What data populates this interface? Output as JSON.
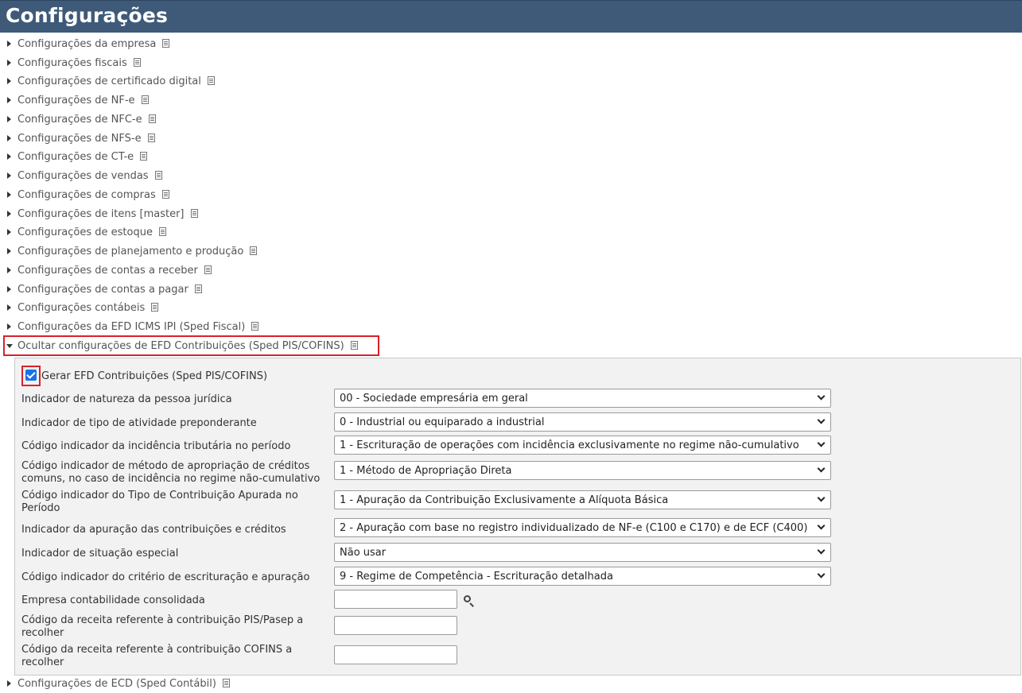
{
  "header": {
    "title": "Configurações"
  },
  "menu": {
    "items": [
      {
        "label": "Configurações da empresa"
      },
      {
        "label": "Configurações fiscais"
      },
      {
        "label": "Configurações de certificado digital"
      },
      {
        "label": "Configurações de NF-e"
      },
      {
        "label": "Configurações de NFC-e"
      },
      {
        "label": "Configurações de NFS-e"
      },
      {
        "label": "Configurações de CT-e"
      },
      {
        "label": "Configurações de vendas"
      },
      {
        "label": "Configurações de compras"
      },
      {
        "label": "Configurações de itens [master]"
      },
      {
        "label": "Configurações de estoque"
      },
      {
        "label": "Configurações de planejamento e produção"
      },
      {
        "label": "Configurações de contas a receber"
      },
      {
        "label": "Configurações de contas a pagar"
      },
      {
        "label": "Configurações contábeis"
      },
      {
        "label": "Configurações da EFD ICMS IPI (Sped Fiscal)"
      }
    ],
    "expanded": {
      "label": "Ocultar configurações de EFD Contribuições (Sped PIS/COFINS)"
    },
    "after": {
      "label": "Configurações de ECD (Sped Contábil)"
    }
  },
  "panel": {
    "checkbox": {
      "label": "Gerar EFD Contribuições (Sped PIS/COFINS)",
      "checked": true
    },
    "fields": [
      {
        "label": "Indicador de natureza da pessoa jurídica",
        "value": "00 - Sociedade empresária em geral"
      },
      {
        "label": "Indicador de tipo de atividade preponderante",
        "value": "0 - Industrial ou equiparado a industrial"
      },
      {
        "label": "Código indicador da incidência tributária no período",
        "value": "1 - Escrituração de operações com incidência exclusivamente no regime não-cumulativo"
      },
      {
        "label_line1": "Código indicador de método de apropriação de créditos",
        "label_line2": "comuns, no caso de incidência no regime não-cumulativo",
        "value": "1 - Método de Apropriação Direta"
      },
      {
        "label_line1": "Código indicador do Tipo de Contribuição Apurada no",
        "label_line2": "Período",
        "value": "1 - Apuração da Contribuição Exclusivamente a Alíquota Básica"
      },
      {
        "label": "Indicador da apuração das contribuições e créditos",
        "value": "2 - Apuração com base no registro individualizado de NF-e (C100 e C170) e de ECF (C400)"
      },
      {
        "label": "Indicador de situação especial",
        "value": "Não usar"
      },
      {
        "label": "Código indicador do critério de escrituração e apuração",
        "value": "9 - Regime de Competência - Escrituração detalhada"
      }
    ],
    "empresa_consolidada": {
      "label": "Empresa contabilidade consolidada",
      "value": ""
    },
    "receita_pis": {
      "label_line1": "Código da receita referente à contribuição PIS/Pasep a",
      "label_line2": "recolher",
      "value": ""
    },
    "receita_cofins": {
      "label_line1": "Código da receita referente à contribuição COFINS a",
      "label_line2": "recolher",
      "value": ""
    }
  },
  "icons": {
    "item_doc": "document-icon",
    "search": "search-icon",
    "checkbox": "checkbox-icon"
  },
  "colors": {
    "header_bg": "#3e5a78",
    "highlight": "#d9212a",
    "checkbox": "#1a73e8"
  }
}
